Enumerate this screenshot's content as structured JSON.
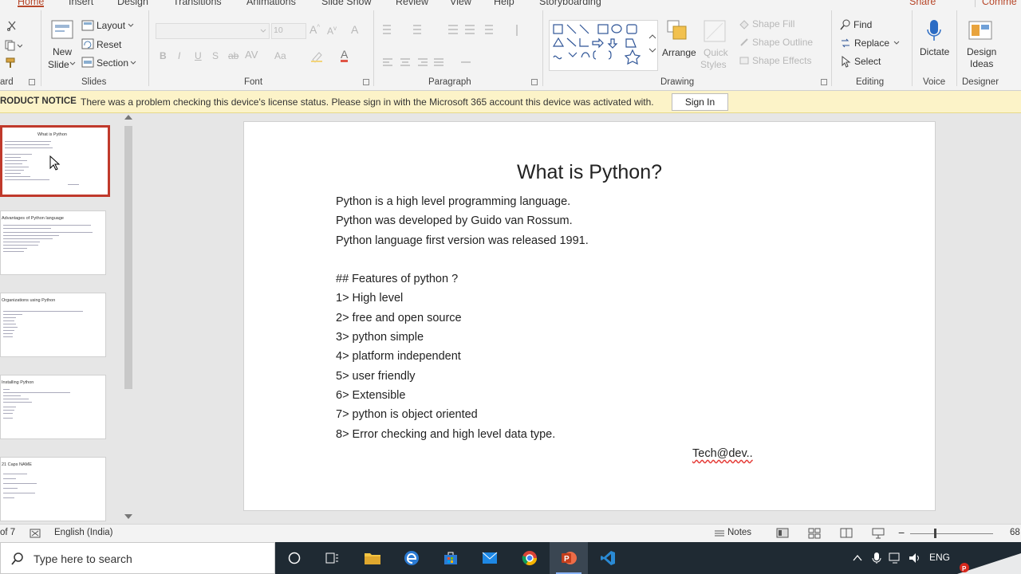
{
  "tabs": [
    "Home",
    "Insert",
    "Design",
    "Transitions",
    "Animations",
    "Slide Show",
    "Review",
    "View",
    "Help",
    "Storyboarding"
  ],
  "share_label": "Share",
  "comments_label": "Comme",
  "ribbon": {
    "clipboard": {
      "label": "ard"
    },
    "slides": {
      "label": "Slides",
      "new_slide": [
        "New",
        "Slide"
      ],
      "layout": "Layout",
      "reset": "Reset",
      "section": "Section"
    },
    "font": {
      "label": "Font",
      "size_value": "10"
    },
    "paragraph": {
      "label": "Paragraph"
    },
    "drawing": {
      "label": "Drawing",
      "arrange": "Arrange",
      "quick_styles": [
        "Quick",
        "Styles"
      ],
      "shape_fill": "Shape Fill",
      "shape_outline": "Shape Outline",
      "shape_effects": "Shape Effects"
    },
    "editing": {
      "label": "Editing",
      "find": "Find",
      "replace": "Replace",
      "select": "Select"
    },
    "voice": {
      "label": "Voice",
      "dictate": "Dictate"
    },
    "designer": {
      "label": "Designer",
      "design_ideas": [
        "Design",
        "Ideas"
      ]
    }
  },
  "notice": {
    "label": "RODUCT NOTICE",
    "message": "There was a problem checking this device's license status. Please sign in with the Microsoft 365 account this device was activated with.",
    "button": "Sign In"
  },
  "thumbnails": [
    {
      "title": "What is Python",
      "selected": true
    },
    {
      "title": "Advantages of Python language",
      "selected": false
    },
    {
      "title": "Organizations using Python",
      "selected": false
    },
    {
      "title": "Installing Python",
      "selected": false
    },
    {
      "title": "21 Caps NAME",
      "selected": false
    }
  ],
  "slide": {
    "title": "What is Python?",
    "lines": [
      "Python is a high level programming language.",
      "Python was developed by Guido van Rossum.",
      "Python language first version was released 1991.",
      "",
      "## Features of python ?",
      "1> High level",
      "2> free and open source",
      "3> python simple",
      "4> platform independent",
      "5> user friendly",
      "6> Extensible",
      "7> python is object oriented",
      "8> Error checking and high level data type."
    ],
    "signature": "Tech@dev.."
  },
  "status": {
    "slide_counter": "of 7",
    "language": "English (India)",
    "notes": "Notes",
    "zoom": "68"
  },
  "taskbar": {
    "search_placeholder": "Type here to search",
    "lang": "ENG"
  },
  "colors": {
    "accent": "#b7472a",
    "notice_bg": "#fcf3c8",
    "selection": "#c0392b",
    "taskbar": "#1f2a33"
  }
}
